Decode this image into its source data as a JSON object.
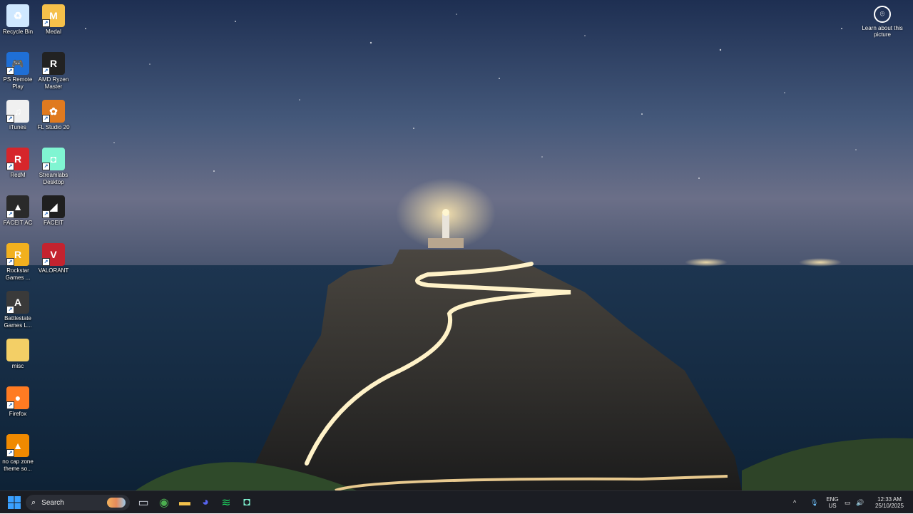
{
  "desktop": {
    "icons": [
      {
        "label": "Recycle Bin",
        "icon": "recycle-bin-icon",
        "color": "#cfe8ff",
        "glyph": "♻"
      },
      {
        "label": "Medal",
        "icon": "medal-icon",
        "color": "#f5c04a",
        "glyph": "M"
      },
      {
        "label": "PS Remote Play",
        "icon": "ps-remote-play-icon",
        "color": "#1f6fd6",
        "glyph": "🎮"
      },
      {
        "label": "AMD Ryzen Master",
        "icon": "amd-ryzen-master-icon",
        "color": "#222222",
        "glyph": "R"
      },
      {
        "label": "iTunes",
        "icon": "itunes-icon",
        "color": "#f0f0f0",
        "glyph": "♫"
      },
      {
        "label": "FL Studio 20",
        "icon": "fl-studio-icon",
        "color": "#e07a1f",
        "glyph": "✿"
      },
      {
        "label": "RedM",
        "icon": "redm-icon",
        "color": "#d6262b",
        "glyph": "R"
      },
      {
        "label": "Streamlabs Desktop",
        "icon": "streamlabs-icon",
        "color": "#80f5d2",
        "glyph": "◘"
      },
      {
        "label": "FACEIT AC",
        "icon": "faceit-ac-icon",
        "color": "#2a2a2a",
        "glyph": "▲"
      },
      {
        "label": "FACEIT",
        "icon": "faceit-icon",
        "color": "#1f1f1f",
        "glyph": "◢"
      },
      {
        "label": "Rockstar Games ...",
        "icon": "rockstar-games-icon",
        "color": "#f2b01e",
        "glyph": "R"
      },
      {
        "label": "VALORANT",
        "icon": "valorant-icon",
        "color": "#c4232f",
        "glyph": "V"
      },
      {
        "label": "Battlestate Games L...",
        "icon": "battlestate-games-icon",
        "color": "#3a3a3a",
        "glyph": "A"
      },
      {
        "label": "misc",
        "icon": "folder-icon",
        "color": "#f3cf66",
        "glyph": ""
      },
      {
        "label": "Firefox",
        "icon": "firefox-icon",
        "color": "#ff7b22",
        "glyph": "●"
      },
      {
        "label": "no cap zone theme so...",
        "icon": "vlc-icon",
        "color": "#f08a00",
        "glyph": "▲"
      }
    ],
    "learn_about": "Learn about this picture"
  },
  "taskbar": {
    "search_placeholder": "Search",
    "apps": [
      {
        "name": "task-view",
        "color": "#d0d4de",
        "glyph": "▭"
      },
      {
        "name": "chrome",
        "color": "#4caf50",
        "glyph": "◉"
      },
      {
        "name": "file-explorer",
        "color": "#f3c14b",
        "glyph": "▬"
      },
      {
        "name": "discord",
        "color": "#5865f2",
        "glyph": "◕"
      },
      {
        "name": "spotify",
        "color": "#1ed760",
        "glyph": "≋"
      },
      {
        "name": "streamlabs",
        "color": "#80f5d2",
        "glyph": "◘"
      }
    ],
    "tray": {
      "lang_top": "ENG",
      "lang_bottom": "US",
      "time": "12:33 AM",
      "date": "25/10/2025"
    }
  }
}
